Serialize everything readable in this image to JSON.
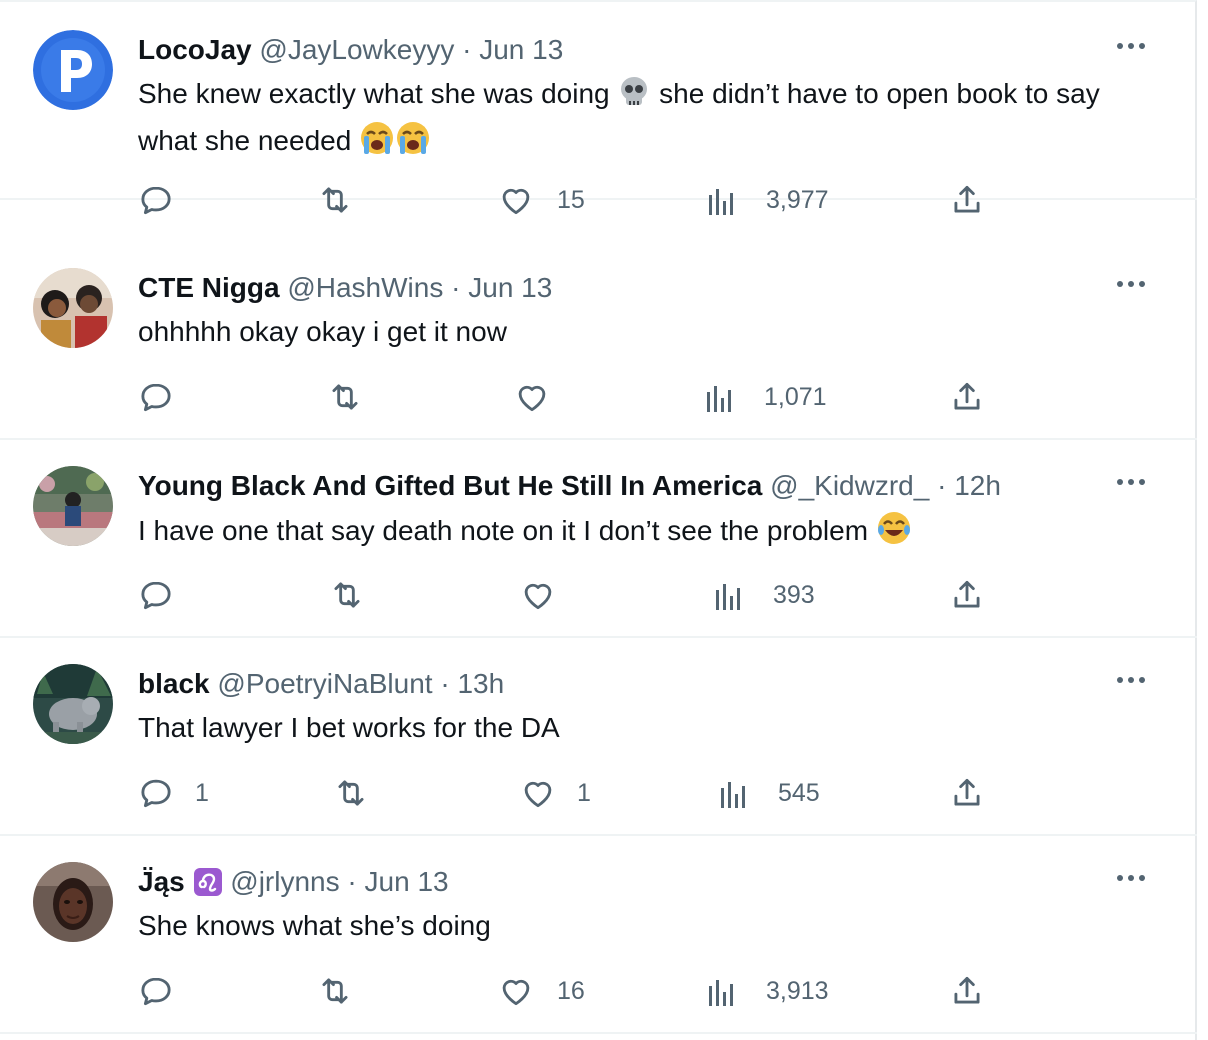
{
  "colors": {
    "text": "#0f1419",
    "muted": "#536471",
    "divider": "#eff3f4"
  },
  "tweets": [
    {
      "name": "LocoJay",
      "handle": "@JayLowkeyyy",
      "sep": "·",
      "time": "Jun 13",
      "text_a": "She knew exactly what she was doing",
      "text_b": "she didn’t have to open book to say what she needed",
      "replies": "",
      "likes": "15",
      "views": "3,977"
    },
    {
      "name": "CTE Nigga",
      "handle": "@HashWins",
      "sep": "·",
      "time": "Jun 13",
      "text": "ohhhhh okay okay i get it now",
      "replies": "",
      "likes": "",
      "views": "1,071"
    },
    {
      "name": "Young Black And Gifted But He Still In America",
      "handle": "@_Kidwzrd_",
      "sep": "·",
      "time": "12h",
      "text": "I have one that say death note on it I don’t see the problem",
      "replies": "",
      "likes": "",
      "views": "393"
    },
    {
      "name": "black",
      "handle": "@PoetryiNaBlunt",
      "sep": "·",
      "time": "13h",
      "text": "That lawyer I bet works for the DA",
      "replies": "1",
      "likes": "1",
      "views": "545"
    },
    {
      "name": "J̈ąs",
      "handle": "@jrlynns",
      "sep": "·",
      "time": "Jun 13",
      "text": "She knows what she’s doing",
      "replies": "",
      "likes": "16",
      "views": "3,913"
    }
  ],
  "icons": {
    "reply": "reply-icon",
    "retweet": "retweet-icon",
    "like": "heart-icon",
    "views": "views-icon",
    "share": "share-icon",
    "more": "more-icon"
  }
}
